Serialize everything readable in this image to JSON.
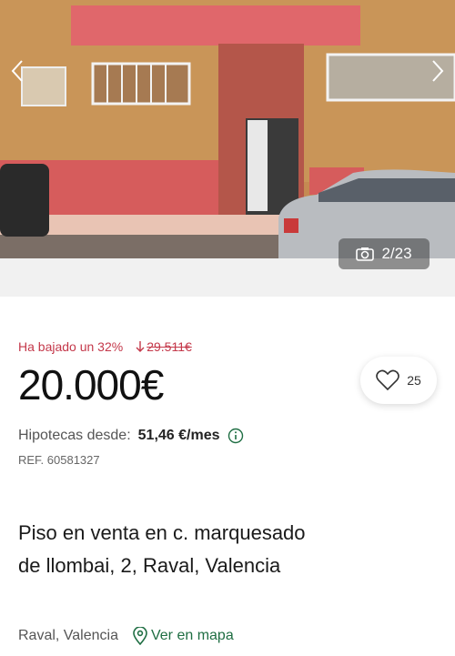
{
  "gallery": {
    "counter": "2/23",
    "icons": {
      "prev": "chevron-left-icon",
      "next": "chevron-right-icon",
      "camera": "camera-icon"
    }
  },
  "listing": {
    "price_drop": "Ha bajado un 32%",
    "old_price": "29.511€",
    "price": "20.000€",
    "favorites_count": "25",
    "mortgage_label": "Hipotecas desde:",
    "mortgage_value": "51,46 €/mes",
    "ref": "REF. 60581327",
    "title": "Piso en venta en c. marquesado de llombai, 2, Raval, Valencia",
    "location": "Raval, Valencia",
    "map_link": "Ver en mapa"
  },
  "colors": {
    "drop": "#c4384a",
    "map_link": "#1f6e43"
  }
}
